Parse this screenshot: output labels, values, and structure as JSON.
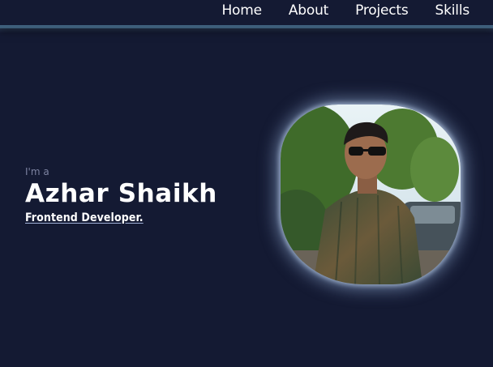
{
  "nav": {
    "items": [
      {
        "label": "Home"
      },
      {
        "label": "About"
      },
      {
        "label": "Projects"
      },
      {
        "label": "Skills"
      }
    ]
  },
  "hero": {
    "intro": "I'm a",
    "name": "Azhar Shaikh",
    "role": "Frontend Developer."
  },
  "colors": {
    "background": "#141a33",
    "nav_border": "#2e4a63",
    "photo_glow": "#a0bee6"
  }
}
